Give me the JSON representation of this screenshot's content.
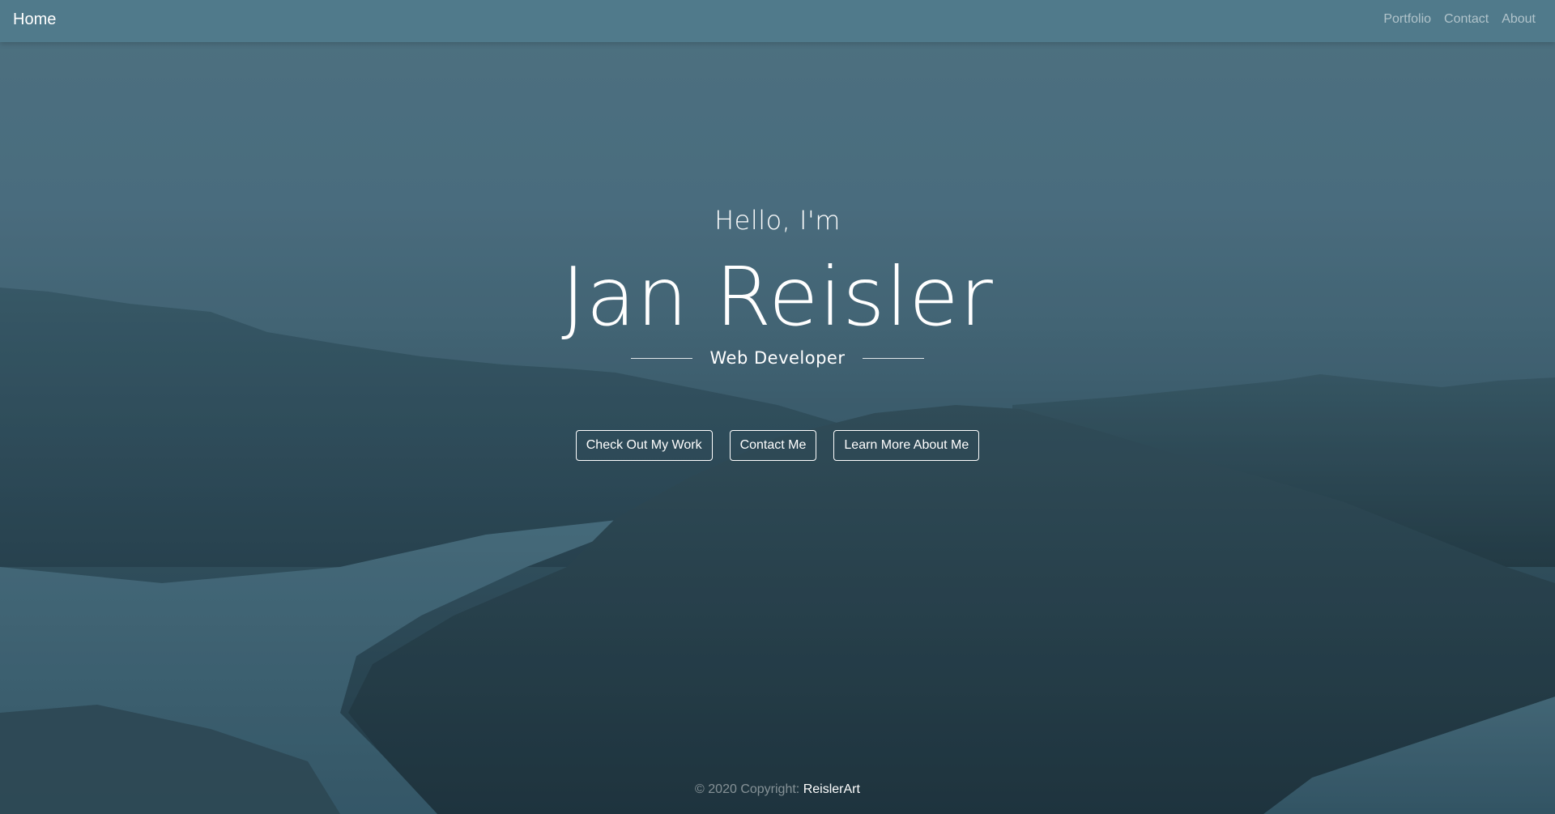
{
  "navbar": {
    "brand": "Home",
    "links": [
      "Portfolio",
      "Contact",
      "About"
    ]
  },
  "hero": {
    "greeting": "Hello, I'm",
    "name": "Jan Reisler",
    "role": "Web Developer",
    "buttons": [
      "Check Out My Work",
      "Contact Me",
      "Learn More About Me"
    ]
  },
  "footer": {
    "copyright": "© 2020 Copyright:",
    "link": "ReislerArt"
  },
  "colors": {
    "navbar": "#507b8c",
    "sky": "#587e8c",
    "text": "#ffffff"
  }
}
